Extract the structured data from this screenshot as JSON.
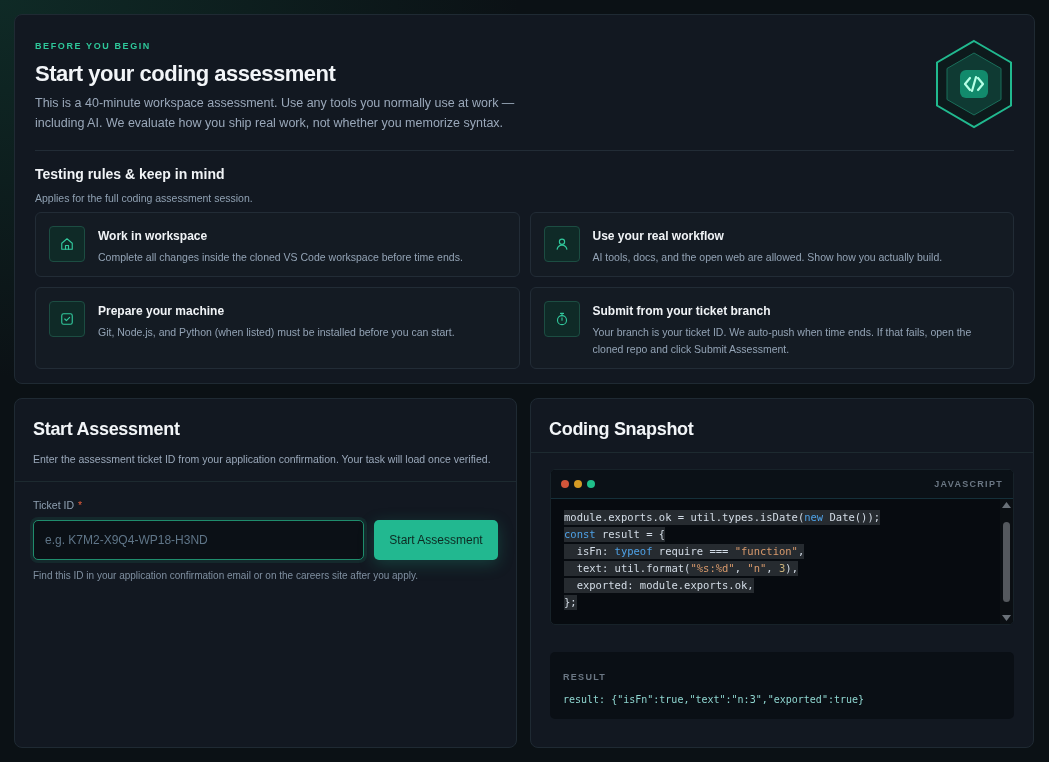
{
  "intro": {
    "eyebrow": "BEFORE YOU BEGIN",
    "title": "Start your coding assessment",
    "description": "This is a 40-minute workspace assessment. Use any tools you normally use at work — including AI. We evaluate how you ship real work, not whether you memorize syntax.",
    "rules_title": "Testing rules & keep in mind",
    "rules_subtitle": "Applies for the full coding assessment session."
  },
  "rules": [
    {
      "kind": "home",
      "title": "Work in workspace",
      "text": "Complete all changes inside the cloned VS Code workspace before time ends."
    },
    {
      "kind": "person",
      "title": "Use your real workflow",
      "text": "AI tools, docs, and the open web are allowed. Show how you actually build."
    },
    {
      "kind": "check",
      "title": "Prepare your machine",
      "text": "Git, Node.js, and Python (when listed) must be installed before you can start."
    },
    {
      "kind": "timer",
      "title": "Submit from your ticket branch",
      "text": "Your branch is your ticket ID. We auto-push when time ends. If that fails, open the cloned repo and click Submit Assessment."
    }
  ],
  "start": {
    "title": "Start Assessment",
    "description": "Enter the assessment ticket ID from your application confirmation. Your task will load once verified.",
    "field_label": "Ticket ID",
    "required_mark": "*",
    "placeholder": "e.g. K7M2-X9Q4-WP18-H3ND",
    "button": "Start Assessment",
    "hint": "Find this ID in your application confirmation email or on the careers site after you apply."
  },
  "snapshot": {
    "title": "Coding Snapshot",
    "language": "JAVASCRIPT",
    "code_lines": [
      {
        "selected": true,
        "tokens": [
          {
            "kind": "plain",
            "text": "module.exports.ok = util.types.isDate("
          },
          {
            "kind": "keyword",
            "text": "new"
          },
          {
            "kind": "plain",
            "text": " Date());"
          }
        ]
      },
      {
        "selected": true,
        "tokens": [
          {
            "kind": "keyword",
            "text": "const"
          },
          {
            "kind": "plain",
            "text": " result = {"
          }
        ]
      },
      {
        "selected": true,
        "tokens": [
          {
            "kind": "plain",
            "text": "  isFn: "
          },
          {
            "kind": "keyword",
            "text": "typeof"
          },
          {
            "kind": "plain",
            "text": " require === "
          },
          {
            "kind": "string",
            "text": "\"function\""
          },
          {
            "kind": "plain",
            "text": ","
          }
        ]
      },
      {
        "selected": true,
        "tokens": [
          {
            "kind": "plain",
            "text": "  text: util.format("
          },
          {
            "kind": "string",
            "text": "\"%s:%d\""
          },
          {
            "kind": "plain",
            "text": ", "
          },
          {
            "kind": "string",
            "text": "\"n\""
          },
          {
            "kind": "plain",
            "text": ", "
          },
          {
            "kind": "number",
            "text": "3"
          },
          {
            "kind": "plain",
            "text": "),"
          }
        ]
      },
      {
        "selected": true,
        "tokens": [
          {
            "kind": "plain",
            "text": "  exported: module.exports.ok,"
          }
        ]
      },
      {
        "selected": true,
        "tokens": [
          {
            "kind": "plain",
            "text": "};"
          }
        ]
      }
    ],
    "result_label": "RESULT",
    "result": "result: {\"isFn\":true,\"text\":\"n:3\",\"exported\":true}"
  }
}
